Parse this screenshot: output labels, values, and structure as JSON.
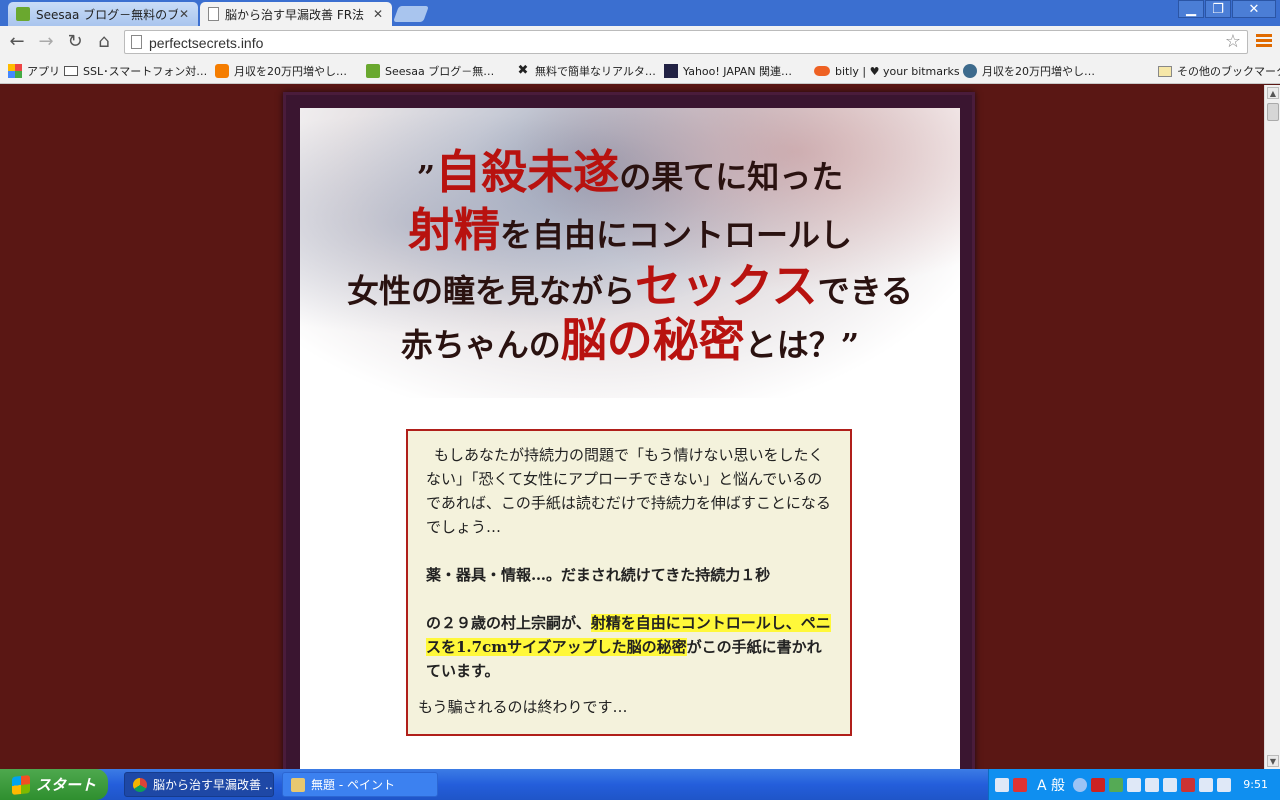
{
  "browser": {
    "tabs": [
      {
        "title": "Seesaa ブログ－無料のブロ",
        "active": false
      },
      {
        "title": "脳から治す早漏改善 FR法",
        "active": true
      }
    ],
    "url": "perfectsecrets.info",
    "window_controls": {
      "minimize": "▁",
      "restore": "❐",
      "close": "✕"
    },
    "bookmarks": [
      {
        "label": "アプリ",
        "icon": "apps-grid-icon"
      },
      {
        "label": "SSL･スマートフォン対…",
        "icon": "mail-icon"
      },
      {
        "label": "月収を20万円増やし…",
        "icon": "blogger-icon"
      },
      {
        "label": "Seesaa ブログ－無…",
        "icon": "seesaa-icon"
      },
      {
        "label": "無料で簡単なリアルタ…",
        "icon": "x-logo-icon"
      },
      {
        "label": "Yahoo! JAPAN 関連…",
        "icon": "unit-search-icon"
      },
      {
        "label": "bitly | ♥ your bitmarks",
        "icon": "bitly-icon"
      },
      {
        "label": "月収を20万円増やし…",
        "icon": "wordpress-icon"
      }
    ],
    "other_bookmarks": "その他のブックマーク"
  },
  "page": {
    "headline": {
      "line1": {
        "open_quote": "”",
        "red": "自殺未遂",
        "rest": "の果てに知った"
      },
      "line2": {
        "red": "射精",
        "rest": "を自由にコントロールし"
      },
      "line3": {
        "pre": "女性の瞳を見ながら",
        "red": "セックス",
        "post": "できる"
      },
      "line4": {
        "pre": "赤ちゃんの",
        "red": "脳の秘密",
        "post": "とは？”"
      }
    },
    "letter": {
      "intro": "もしあなたが持続力の問題で「もう情けない思いをしたくない」「恐くて女性にアプローチできない」と悩んでいるのであれば、この手紙は読むだけで持続力を伸ばすことになるでしょう…",
      "bold1": "薬・器具・情報…。だまされ続けてきた持続力１秒",
      "bold2_pre": "の２９歳の村上宗嗣が、",
      "bold2_mark": "射精を自由にコントロールし、ペニスを1.7cmサイズアップした脳の秘密",
      "bold2_post": "がこの手紙に書かれています。",
      "closing": "もう騙されるのは終わりです…"
    },
    "colors": {
      "background": "#5a1714",
      "accent_red": "#b8120f",
      "highlight": "#fff83a",
      "letter_bg": "#f4f2dc"
    }
  },
  "taskbar": {
    "start": "スタート",
    "items": [
      {
        "label": "脳から治す早漏改善 …",
        "active": true
      },
      {
        "label": "無題 - ペイント",
        "active": false
      }
    ],
    "ime": "A 般",
    "clock": "9:51"
  }
}
